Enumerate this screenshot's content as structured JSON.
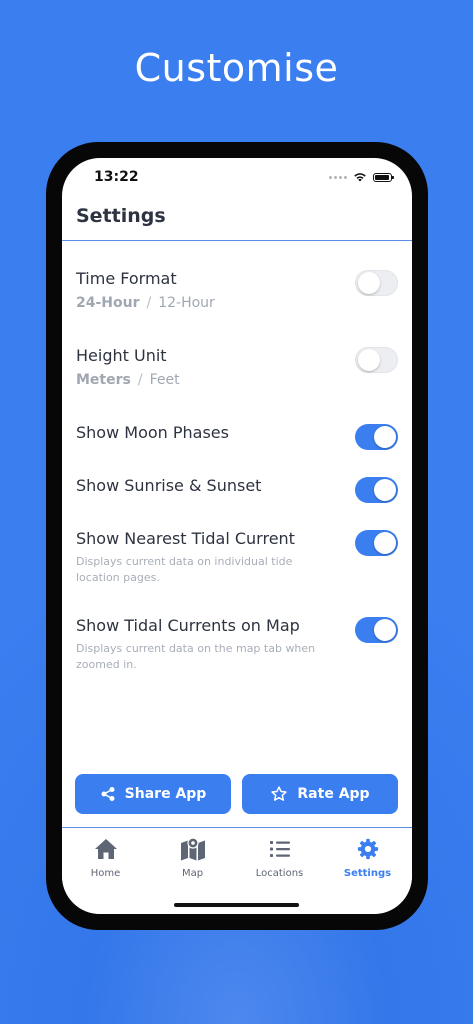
{
  "headline": "Customise",
  "status_bar": {
    "time": "13:22"
  },
  "header": {
    "title": "Settings"
  },
  "settings": {
    "time_format": {
      "label": "Time Format",
      "option_selected": "24-Hour",
      "separator": "/",
      "option_other": "12-Hour",
      "enabled": false
    },
    "height_unit": {
      "label": "Height Unit",
      "option_selected": "Meters",
      "separator": "/",
      "option_other": "Feet",
      "enabled": false
    },
    "moon_phases": {
      "label": "Show Moon Phases",
      "enabled": true
    },
    "sunrise_sunset": {
      "label": "Show Sunrise & Sunset",
      "enabled": true
    },
    "nearest_tidal": {
      "label": "Show Nearest Tidal Current",
      "description": "Displays current data on individual tide location pages.",
      "enabled": true
    },
    "tidal_map": {
      "label": "Show Tidal Currents on Map",
      "description": "Displays current data on the map tab when zoomed in.",
      "enabled": true
    }
  },
  "actions": {
    "share_label": "Share App",
    "share_icon": "share-icon",
    "rate_label": "Rate App",
    "rate_icon": "star-icon"
  },
  "tabs": [
    {
      "label": "Home",
      "icon": "home-icon"
    },
    {
      "label": "Map",
      "icon": "map-icon"
    },
    {
      "label": "Locations",
      "icon": "list-icon"
    },
    {
      "label": "Settings",
      "icon": "gear-icon",
      "active": true
    }
  ],
  "colors": {
    "accent": "#3a7ef0",
    "text": "#2d3340",
    "muted": "#a1a7b2"
  }
}
